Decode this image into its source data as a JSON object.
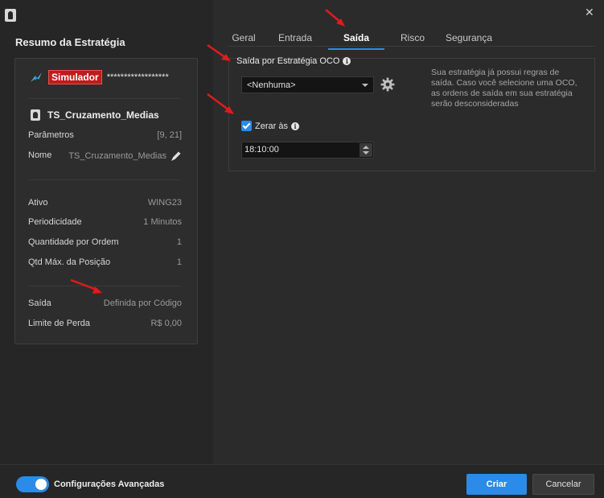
{
  "left": {
    "title": "Resumo da Estratégia",
    "account_badge": "Simulador",
    "account_masked": "******************",
    "strategy_name": "TS_Cruzamento_Medias",
    "params": [
      {
        "label": "Parâmetros",
        "value": "[9, 21]"
      },
      {
        "label": "Nome",
        "value": "TS_Cruzamento_Medias"
      }
    ],
    "details": [
      {
        "label": "Ativo",
        "value": "WING23"
      },
      {
        "label": "Periodicidade",
        "value": "1 Minutos"
      },
      {
        "label": "Quantidade por Ordem",
        "value": "1"
      },
      {
        "label": "Qtd Máx. da Posição",
        "value": "1"
      }
    ],
    "exit": [
      {
        "label": "Saída",
        "value": "Definida por Código"
      },
      {
        "label": "Limite de Perda",
        "value": "R$ 0,00"
      }
    ]
  },
  "tabs": [
    {
      "label": "Geral"
    },
    {
      "label": "Entrada"
    },
    {
      "label": "Saída",
      "active": true
    },
    {
      "label": "Risco"
    },
    {
      "label": "Segurança"
    }
  ],
  "exit_tab": {
    "oco_title": "Saída por Estratégia OCO",
    "oco_select_value": "<Nenhuma>",
    "oco_note": "Sua estratégia já possui regras de saída. Caso você selecione uma OCO, as ordens de saída em sua estratégia serão desconsideradas",
    "zerar_label": "Zerar às",
    "zerar_checked": true,
    "zerar_time": "18:10:00"
  },
  "footer": {
    "advanced_label": "Configurações Avançadas",
    "advanced_on": true,
    "create_label": "Criar",
    "cancel_label": "Cancelar"
  },
  "colors": {
    "accent": "#2b8be6",
    "badge": "#c01b1b",
    "annotation_arrow": "#e01b1b"
  }
}
